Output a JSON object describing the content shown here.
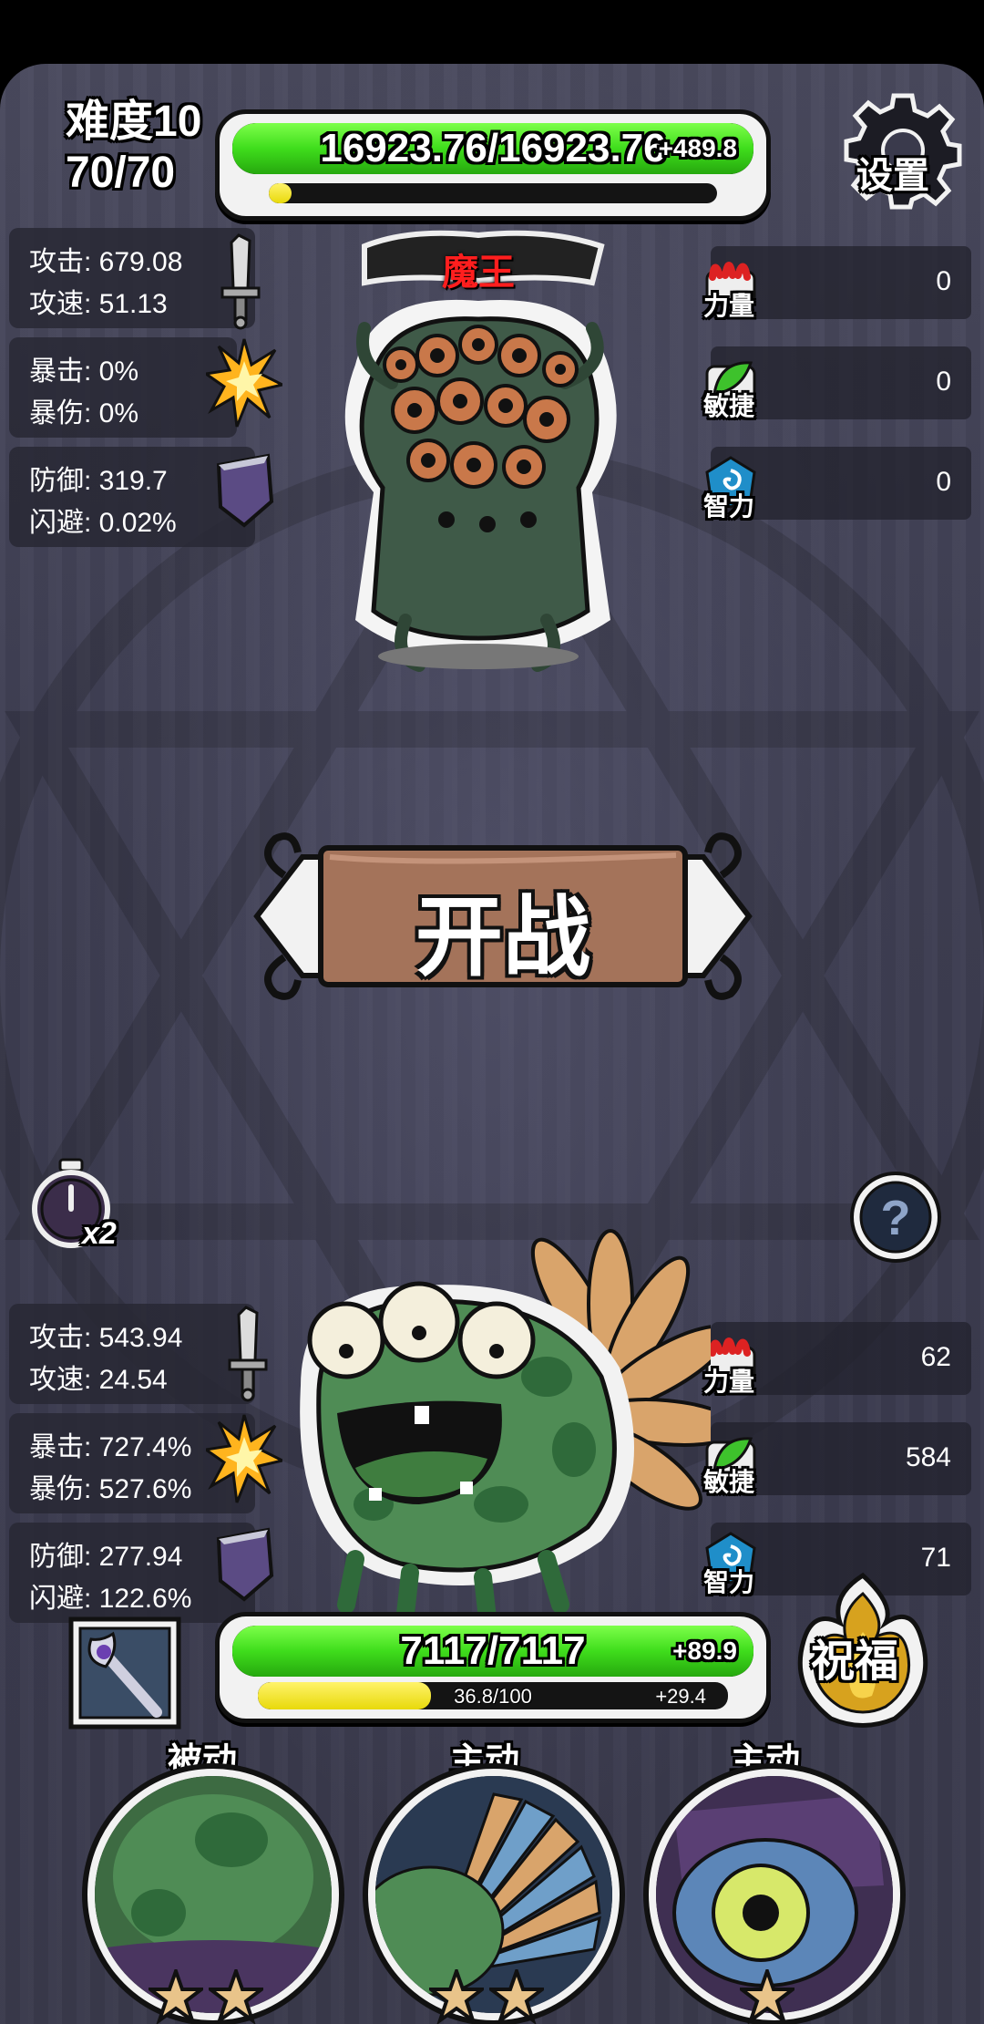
{
  "difficulty": {
    "label": "难度10",
    "progress": "70/70"
  },
  "enemy": {
    "name": "魔王",
    "hp_text": "16923.76/16923.76",
    "hp_fraction": 1.0,
    "hp_regen": "+489.8",
    "xp_fraction": 0.05,
    "stats": {
      "attack": "攻击: 679.08",
      "attack_speed": "攻速: 51.13",
      "crit": "暴击: 0%",
      "crit_damage": "暴伤: 0%",
      "defense": "防御: 319.7",
      "dodge": "闪避: 0.02%"
    },
    "attributes": [
      {
        "label": "力量",
        "value": "0",
        "icon": "strength-claw-icon"
      },
      {
        "label": "敏捷",
        "value": "0",
        "icon": "agility-leaf-icon"
      },
      {
        "label": "智力",
        "value": "0",
        "icon": "intellect-swirl-icon"
      }
    ]
  },
  "settings_label": "设置",
  "battle_button_label": "开战",
  "speed_multiplier": "x2",
  "help_icon": "question-mark-icon",
  "player": {
    "hp_text": "7117/7117",
    "hp_fraction": 1.0,
    "hp_regen": "+89.9",
    "xp_text": "36.8/100",
    "xp_fraction": 0.368,
    "xp_regen": "+29.4",
    "stats": {
      "attack": "攻击: 543.94",
      "attack_speed": "攻速: 24.54",
      "crit": "暴击: 727.4%",
      "crit_damage": "暴伤: 527.6%",
      "defense": "防御: 277.94",
      "dodge": "闪避: 122.6%"
    },
    "attributes": [
      {
        "label": "力量",
        "value": "62",
        "icon": "strength-claw-icon"
      },
      {
        "label": "敏捷",
        "value": "584",
        "icon": "agility-leaf-icon"
      },
      {
        "label": "智力",
        "value": "71",
        "icon": "intellect-swirl-icon"
      }
    ]
  },
  "blessing_label": "祝福",
  "skills": [
    {
      "type": "被动",
      "stars": 2
    },
    {
      "type": "主动",
      "stars": 2
    },
    {
      "type": "主动",
      "stars": 1
    }
  ],
  "colors": {
    "hp_green": "#3fdd1c",
    "xp_yellow": "#e8d90a",
    "enemy_name_red": "#ff1e1e"
  }
}
